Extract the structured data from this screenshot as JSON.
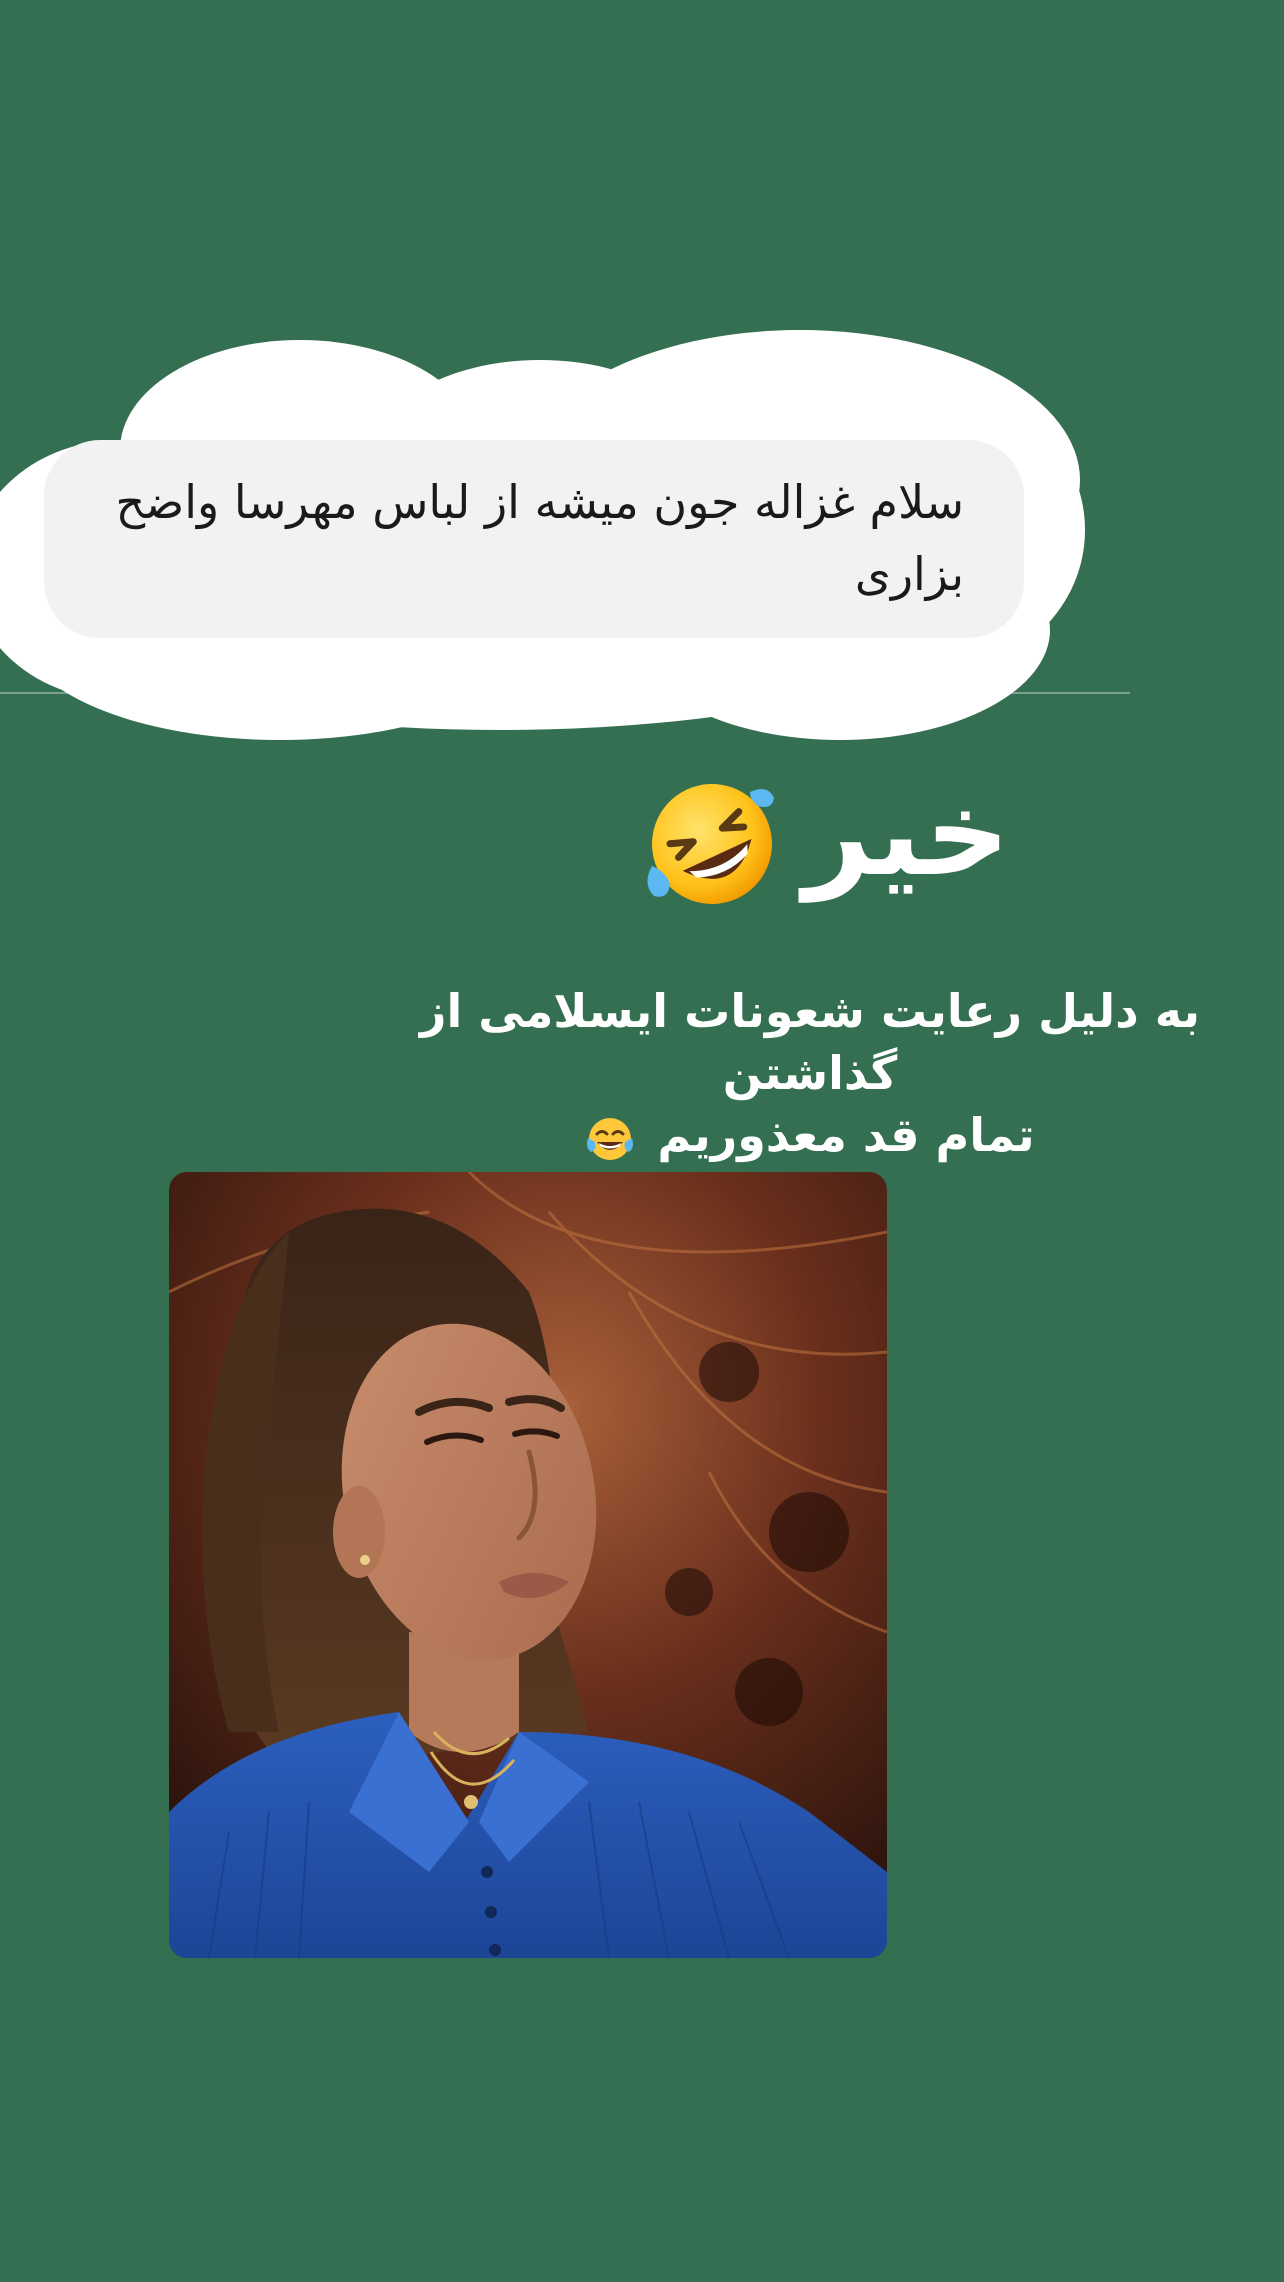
{
  "story": {
    "question_bubble": {
      "text": "سلام غزاله جون میشه از لباس مهرسا واضح بزاری"
    },
    "answer": {
      "word": "خیر",
      "emoji": "rolling-on-floor-laughing-emoji"
    },
    "caption": {
      "line1": "به دلیل رعایت شعونات  ایسلامی از گذاشتن",
      "line2": "تمام قد معذوریم",
      "emoji": "face-with-tears-of-joy-emoji"
    },
    "photo": {
      "subject": "reaction-meme-photo"
    },
    "colors": {
      "background": "#356f51",
      "bubble": "#f2f2f4",
      "cloud": "#ffffff",
      "text_light": "#ffffff",
      "text_dark": "#1a1a1a"
    }
  }
}
